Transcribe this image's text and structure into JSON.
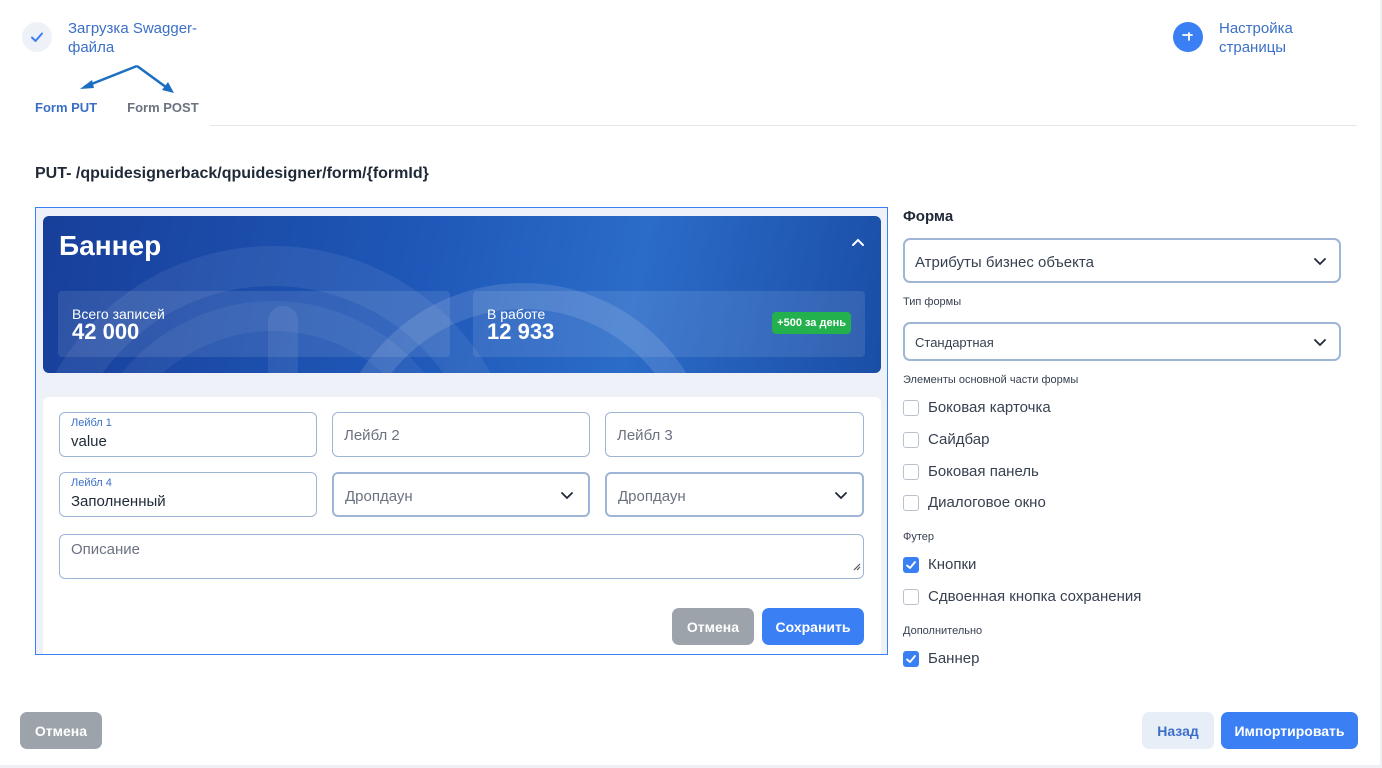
{
  "stepper": {
    "step1_label": "Загрузка Swagger-файла",
    "step2_label": "Настройка страницы"
  },
  "tabs": [
    {
      "label": "Form PUT",
      "active": true
    },
    {
      "label": "Form POST",
      "active": false
    }
  ],
  "endpoint": "PUT- /qpuidesignerback/qpuidesigner/form/{formId}",
  "preview": {
    "banner": {
      "title": "Баннер",
      "stats": [
        {
          "label": "Всего записей",
          "value": "42 000"
        },
        {
          "label": "В работе",
          "value": "12 933",
          "badge": "+500 за день"
        }
      ]
    },
    "fields": {
      "f1_label": "Лейбл 1",
      "f1_value": "value",
      "f2_placeholder": "Лейбл 2",
      "f3_placeholder": "Лейбл 3",
      "f4_label": "Лейбл 4",
      "f4_value": "Заполненный",
      "dd1_placeholder": "Дропдаун",
      "dd2_placeholder": "Дропдаун",
      "desc_placeholder": "Описание"
    },
    "buttons": {
      "cancel": "Отмена",
      "save": "Сохранить"
    }
  },
  "panel": {
    "form_title": "Форма",
    "form_select": "Атрибуты бизнес объекта",
    "form_type_label": "Тип формы",
    "form_type_select": "Стандартная",
    "main_elements_label": "Элементы основной части формы",
    "main_elements": [
      {
        "label": "Боковая карточка",
        "checked": false
      },
      {
        "label": "Сайдбар",
        "checked": false
      },
      {
        "label": "Боковая панель",
        "checked": false
      },
      {
        "label": "Диалоговое окно",
        "checked": false
      }
    ],
    "footer_label": "Футер",
    "footer_items": [
      {
        "label": "Кнопки",
        "checked": true
      },
      {
        "label": "Сдвоенная кнопка сохранения",
        "checked": false
      }
    ],
    "extra_label": "Дополнительно",
    "extra_items": [
      {
        "label": "Баннер",
        "checked": true
      }
    ]
  },
  "footer": {
    "cancel": "Отмена",
    "back": "Назад",
    "import": "Импортировать"
  },
  "colors": {
    "accent": "#3b7ff5",
    "success": "#22b14c",
    "banner": "#1f58b8"
  }
}
